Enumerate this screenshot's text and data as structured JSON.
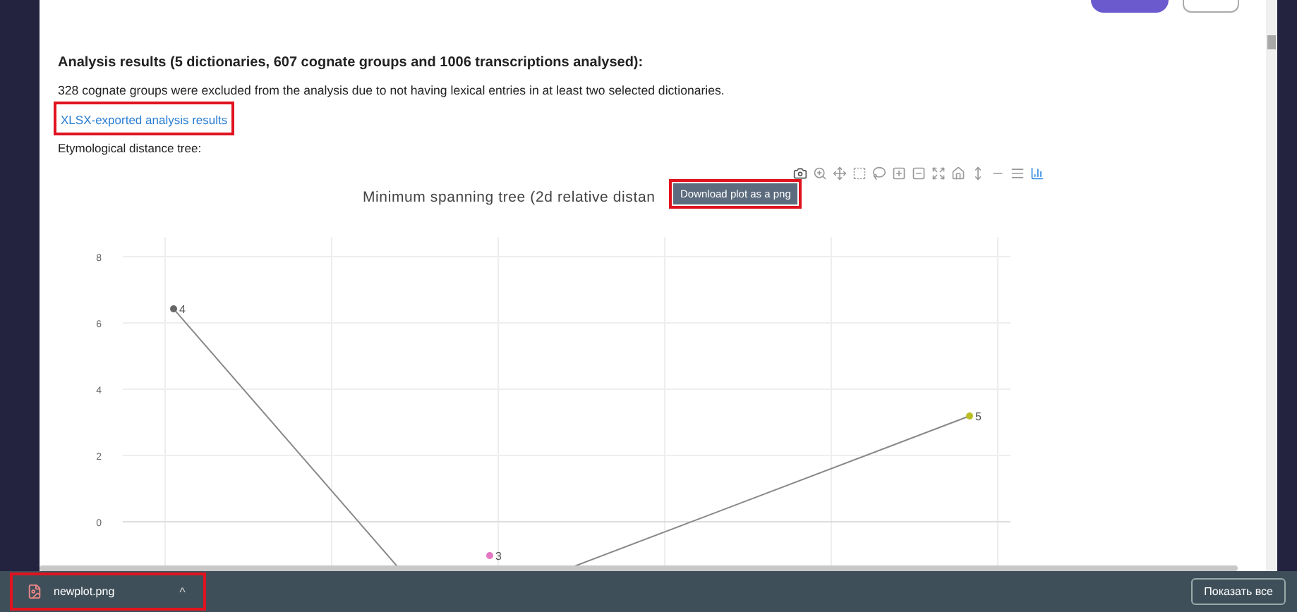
{
  "results": {
    "heading": "Analysis results (5 dictionaries, 607 cognate groups and 1006 transcriptions analysed):",
    "note": "328 cognate groups were excluded from the analysis due to not having lexical entries in at least two selected dictionaries.",
    "export_link": "XLSX-exported analysis results",
    "tree_label": "Etymological distance tree:"
  },
  "plot": {
    "tooltip": "Download plot as a png",
    "title": "Minimum spanning tree (2d relative distan",
    "y_ticks": [
      "8",
      "6",
      "4",
      "2",
      "0"
    ],
    "points": [
      {
        "label": "4",
        "color": "#666666"
      },
      {
        "label": "3",
        "color": "#e377c2"
      },
      {
        "label": "5",
        "color": "#bcbd22"
      }
    ]
  },
  "downloads": {
    "file": "newplot.png",
    "caret": "^",
    "show_all": "Показать все"
  }
}
